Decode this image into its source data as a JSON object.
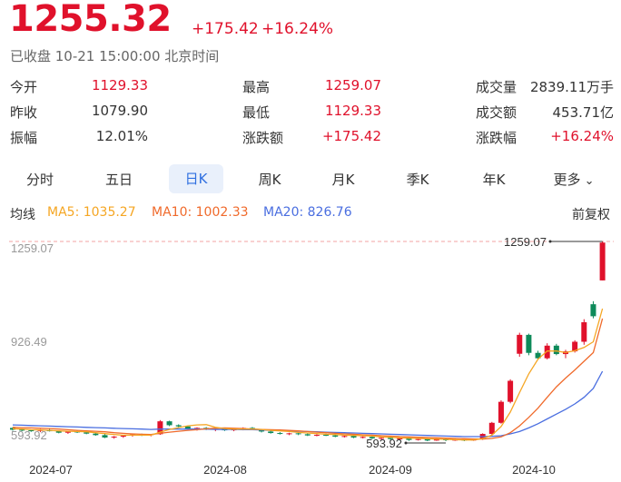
{
  "quote": {
    "price": "1255.32",
    "change": "+175.42",
    "change_pct": "+16.24%",
    "status": "已收盘 10-21 15:00:00 北京时间"
  },
  "stats": [
    {
      "label": "今开",
      "value": "1129.33",
      "color": "red"
    },
    {
      "label": "最高",
      "value": "1259.07",
      "color": "red"
    },
    {
      "label": "成交量",
      "value": "2839.11万手",
      "color": "dark"
    },
    {
      "label": "昨收",
      "value": "1079.90",
      "color": "dark"
    },
    {
      "label": "最低",
      "value": "1129.33",
      "color": "red"
    },
    {
      "label": "成交额",
      "value": "453.71亿",
      "color": "dark"
    },
    {
      "label": "振幅",
      "value": "12.01%",
      "color": "dark"
    },
    {
      "label": "涨跌额",
      "value": "+175.42",
      "color": "red"
    },
    {
      "label": "涨跌幅",
      "value": "+16.24%",
      "color": "red"
    }
  ],
  "tabs": [
    {
      "label": "分时",
      "active": false
    },
    {
      "label": "五日",
      "active": false
    },
    {
      "label": "日K",
      "active": true
    },
    {
      "label": "周K",
      "active": false
    },
    {
      "label": "月K",
      "active": false
    },
    {
      "label": "季K",
      "active": false
    },
    {
      "label": "年K",
      "active": false
    },
    {
      "label": "更多",
      "active": false
    }
  ],
  "legend": {
    "title": "均线",
    "ma5": "MA5: 1035.27",
    "ma10": "MA10: 1002.33",
    "ma20": "MA20: 826.76",
    "adjust": "前复权"
  },
  "colors": {
    "up": "#e0112b",
    "down": "#0e8a5a",
    "ma5": "#f5a623",
    "ma10": "#f06a2b",
    "ma20": "#4a6ee0",
    "active_tab": "#2f6fe0",
    "active_tab_bg": "#e9f0fb"
  },
  "chart_data": {
    "type": "candlestick",
    "y_ticks": [
      "1259.07",
      "926.49",
      "593.92"
    ],
    "ylim": [
      593.92,
      1259.07
    ],
    "x_ticks": [
      "2024-07",
      "2024-08",
      "2024-09",
      "2024-10"
    ],
    "max_label": "1259.07",
    "min_label": "593.92",
    "candles": [
      [
        638,
        640,
        629,
        632
      ],
      [
        632,
        636,
        627,
        630
      ],
      [
        630,
        633,
        625,
        628
      ],
      [
        628,
        634,
        624,
        631
      ],
      [
        631,
        635,
        626,
        627
      ],
      [
        627,
        630,
        620,
        622
      ],
      [
        622,
        628,
        618,
        626
      ],
      [
        626,
        630,
        621,
        623
      ],
      [
        623,
        627,
        617,
        619
      ],
      [
        619,
        624,
        612,
        614
      ],
      [
        614,
        618,
        604,
        606
      ],
      [
        606,
        611,
        602,
        609
      ],
      [
        609,
        614,
        605,
        612
      ],
      [
        612,
        618,
        609,
        616
      ],
      [
        616,
        619,
        611,
        614
      ],
      [
        614,
        618,
        610,
        617
      ],
      [
        617,
        664,
        615,
        660
      ],
      [
        660,
        662,
        644,
        647
      ],
      [
        647,
        650,
        640,
        643
      ],
      [
        643,
        645,
        633,
        636
      ],
      [
        636,
        640,
        629,
        638
      ],
      [
        638,
        641,
        631,
        633
      ],
      [
        633,
        637,
        627,
        635
      ],
      [
        635,
        638,
        628,
        630
      ],
      [
        630,
        636,
        627,
        634
      ],
      [
        634,
        640,
        630,
        638
      ],
      [
        638,
        641,
        631,
        633
      ],
      [
        633,
        635,
        623,
        626
      ],
      [
        626,
        629,
        619,
        621
      ],
      [
        621,
        624,
        616,
        618
      ],
      [
        618,
        622,
        614,
        620
      ],
      [
        620,
        623,
        614,
        617
      ],
      [
        617,
        620,
        611,
        613
      ],
      [
        613,
        617,
        610,
        615
      ],
      [
        615,
        619,
        611,
        613
      ],
      [
        613,
        616,
        607,
        609
      ],
      [
        609,
        613,
        606,
        611
      ],
      [
        611,
        614,
        604,
        606
      ],
      [
        606,
        610,
        603,
        608
      ],
      [
        608,
        611,
        601,
        603
      ],
      [
        603,
        607,
        599,
        605
      ],
      [
        605,
        608,
        598,
        601
      ],
      [
        601,
        605,
        597,
        603
      ],
      [
        603,
        606,
        595,
        598
      ],
      [
        598,
        603,
        596,
        601
      ],
      [
        601,
        604,
        594,
        596
      ],
      [
        596,
        602,
        595,
        600
      ],
      [
        600,
        603,
        593.92,
        597
      ],
      [
        597,
        601,
        595,
        599
      ],
      [
        599,
        602,
        594,
        596
      ],
      [
        596,
        602,
        595,
        600
      ],
      [
        600,
        620,
        598,
        618
      ],
      [
        618,
        658,
        616,
        655
      ],
      [
        655,
        730,
        652,
        725
      ],
      [
        725,
        800,
        720,
        795
      ],
      [
        885,
        955,
        875,
        948
      ],
      [
        948,
        952,
        880,
        888
      ],
      [
        888,
        895,
        865,
        870
      ],
      [
        870,
        920,
        866,
        912
      ],
      [
        912,
        918,
        880,
        884
      ],
      [
        884,
        898,
        870,
        893
      ],
      [
        893,
        930,
        889,
        925
      ],
      [
        925,
        1000,
        915,
        990
      ],
      [
        1050,
        1060,
        1003,
        1010
      ],
      [
        1129.33,
        1259.07,
        1129.33,
        1255.32
      ]
    ],
    "ma5": [
      635,
      634,
      632,
      631,
      630,
      628,
      627,
      626,
      625,
      622,
      619,
      616,
      614,
      614,
      614,
      614,
      624,
      633,
      639,
      645,
      648,
      649,
      640,
      636,
      634,
      634,
      634,
      633,
      630,
      628,
      626,
      623,
      621,
      619,
      617,
      616,
      614,
      613,
      612,
      611,
      608,
      607,
      605,
      604,
      603,
      602,
      601,
      600,
      599,
      598,
      598,
      602,
      614,
      643,
      691,
      756,
      818,
      867,
      894,
      894,
      889,
      895,
      906,
      925,
      1035.27
    ],
    "ma10": [
      640,
      639,
      638,
      637,
      636,
      634,
      632,
      630,
      628,
      627,
      625,
      622,
      620,
      618,
      617,
      616,
      620,
      624,
      627,
      630,
      632,
      635,
      637,
      638,
      637,
      636,
      634,
      633,
      632,
      631,
      630,
      628,
      626,
      624,
      622,
      620,
      618,
      617,
      615,
      614,
      612,
      611,
      609,
      608,
      607,
      606,
      605,
      604,
      603,
      602,
      601,
      601,
      603,
      608,
      622,
      645,
      673,
      704,
      740,
      775,
      804,
      831,
      860,
      889,
      1002.33
    ],
    "ma20": [
      648,
      647,
      646,
      645,
      644,
      643,
      642,
      641,
      640,
      639,
      638,
      637,
      636,
      635,
      634,
      633,
      634,
      634,
      634,
      634,
      634,
      634,
      633,
      633,
      633,
      632,
      632,
      631,
      630,
      629,
      628,
      627,
      626,
      625,
      624,
      623,
      622,
      621,
      620,
      619,
      618,
      617,
      616,
      615,
      614,
      613,
      612,
      611,
      610,
      609,
      609,
      609,
      610,
      612,
      618,
      626,
      638,
      652,
      668,
      684,
      700,
      718,
      740,
      770,
      826.76
    ]
  }
}
